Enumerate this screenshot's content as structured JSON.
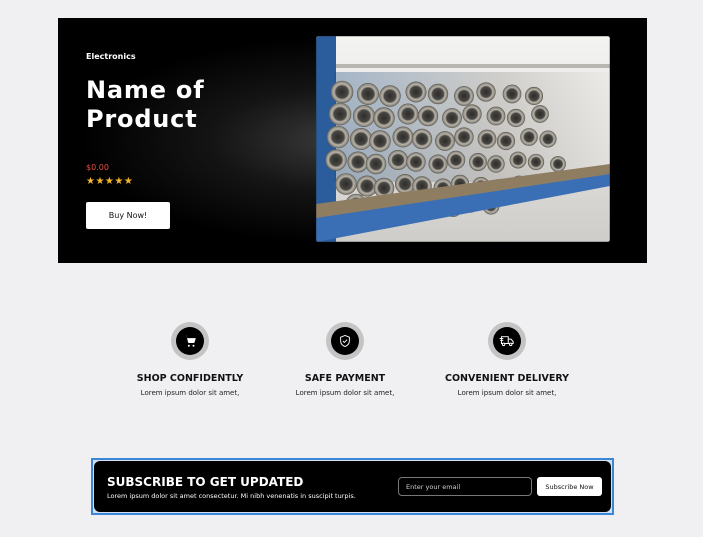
{
  "hero": {
    "category": "Electronics",
    "title": "Name of Product",
    "price": "$0.00",
    "rating": 5,
    "stars_text": "★★★★★",
    "cta_label": "Buy Now!",
    "image_subject": "stacked-metal-pipes-photo",
    "colors": {
      "price": "#e84a3c",
      "stars": "#f5b52e",
      "background": "#000000"
    }
  },
  "features": [
    {
      "icon": "shopping-cart-icon",
      "title": "SHOP CONFIDENTLY",
      "text": "Lorem ipsum dolor sit amet,"
    },
    {
      "icon": "shield-check-icon",
      "title": "SAFE PAYMENT",
      "text": "Lorem ipsum dolor sit amet,"
    },
    {
      "icon": "delivery-truck-icon",
      "title": "CONVENIENT DELIVERY",
      "text": "Lorem ipsum dolor sit amet,"
    }
  ],
  "subscribe": {
    "title": "SUBSCRIBE TO GET UPDATED",
    "text": "Lorem ipsum dolor sit amet consectetur. Mi nibh venenatis in suscipit turpis.",
    "email_placeholder": "Enter your email",
    "button_label": "Subscribe Now",
    "colors": {
      "selection_outline": "#3b86d6"
    }
  }
}
